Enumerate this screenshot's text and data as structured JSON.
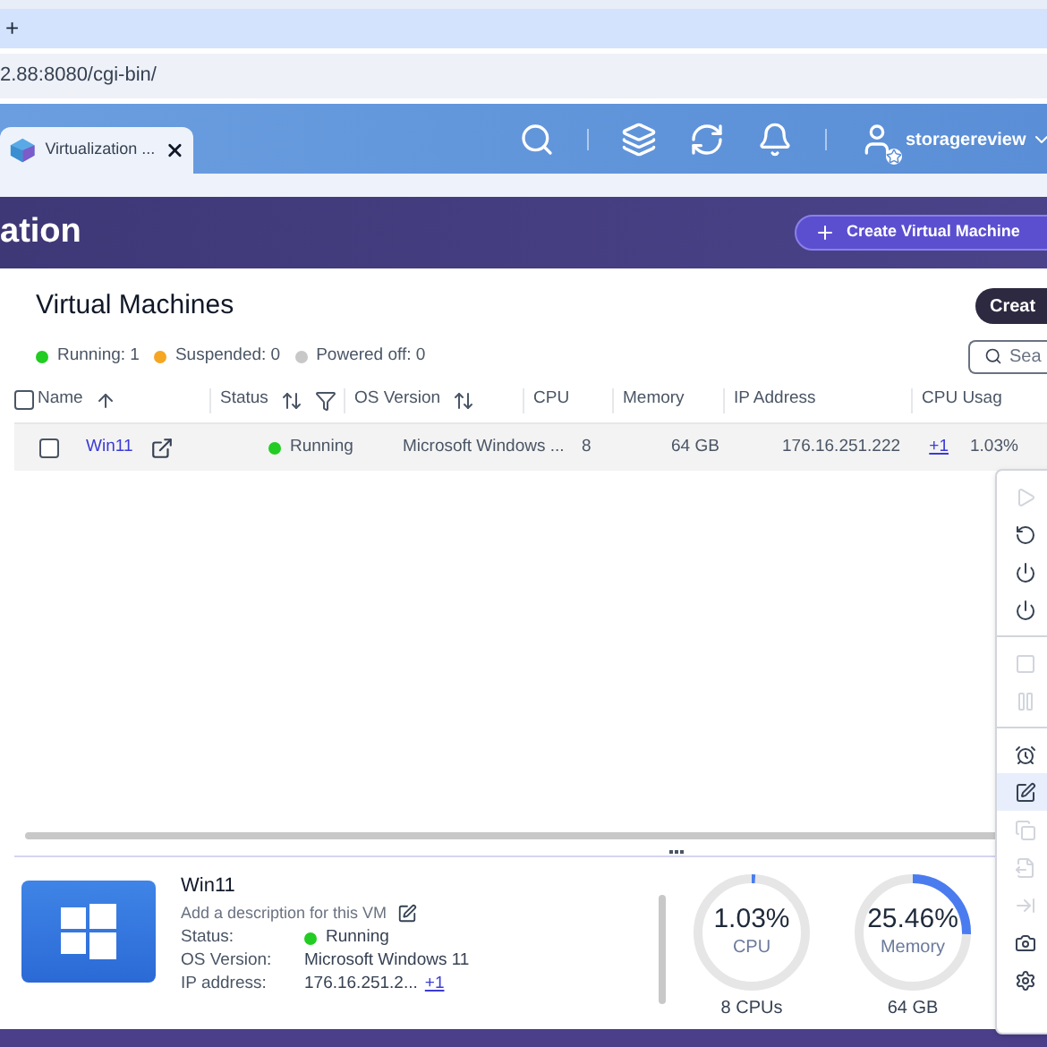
{
  "browser": {
    "new_tab": "+",
    "address": "2.88:8080/cgi-bin/"
  },
  "topbar": {
    "app_tab": "Virtualization ...",
    "user": "storagereview"
  },
  "header": {
    "title": "ation",
    "create_button": "Create Virtual Machine"
  },
  "section": {
    "title": "Virtual Machines",
    "create_button": "Creat",
    "search_placeholder": "Sea"
  },
  "legend": [
    {
      "label": "Running: 1",
      "color": "#22cc22"
    },
    {
      "label": "Suspended: 0",
      "color": "#f5a623"
    },
    {
      "label": "Powered off: 0",
      "color": "#c8c8c8"
    }
  ],
  "table": {
    "all_checked": false,
    "columns": [
      {
        "label": "Name",
        "sortable": true,
        "sorted": true
      },
      {
        "label": "Status",
        "sortable": true,
        "sorted": false,
        "filter": true
      },
      {
        "label": "OS Version",
        "sortable": true,
        "sorted": false
      },
      {
        "label": "CPU"
      },
      {
        "label": "Memory"
      },
      {
        "label": "IP Address"
      },
      {
        "label": "CPU Usag"
      }
    ],
    "rows": [
      {
        "checked": false,
        "name": "Win11",
        "status": "Running",
        "color": "#22cc22",
        "os": "Microsoft Windows ...",
        "cpu": "8",
        "memory": "64 GB",
        "ip": "176.16.251.222",
        "ip_more": "+1",
        "cpu_usage": "1.03%"
      }
    ]
  },
  "menu": [
    {
      "kind": "item",
      "disabled": true,
      "selected": false
    },
    {
      "kind": "item",
      "disabled": false,
      "selected": false
    },
    {
      "kind": "item",
      "disabled": false,
      "selected": false
    },
    {
      "kind": "item",
      "disabled": false,
      "selected": false
    },
    {
      "kind": "divider"
    },
    {
      "kind": "item",
      "disabled": true,
      "selected": false
    },
    {
      "kind": "item",
      "disabled": true,
      "selected": false
    },
    {
      "kind": "divider"
    },
    {
      "kind": "item",
      "disabled": false,
      "selected": false
    },
    {
      "kind": "item",
      "disabled": false,
      "selected": true
    },
    {
      "kind": "item",
      "disabled": true,
      "selected": false
    },
    {
      "kind": "item",
      "disabled": true,
      "selected": false
    },
    {
      "kind": "item",
      "disabled": true,
      "selected": false
    },
    {
      "kind": "item",
      "disabled": false,
      "selected": false
    },
    {
      "kind": "item",
      "disabled": false,
      "selected": false
    }
  ],
  "details": {
    "name": "Win11",
    "description": "Add a description for this VM",
    "fields": [
      {
        "label": "Status:",
        "value": "Running",
        "color": "#22cc22"
      },
      {
        "label": "OS Version:",
        "value": "Microsoft Windows 11"
      },
      {
        "label": "IP address:",
        "value": "176.16.251.2...",
        "more": "+1"
      }
    ],
    "gauges": [
      {
        "value": "1.03%",
        "label": "CPU",
        "caption": "8 CPUs",
        "level": 0.0103
      },
      {
        "value": "25.46%",
        "label": "Memory",
        "caption": "64 GB",
        "level": 0.2546
      }
    ]
  }
}
